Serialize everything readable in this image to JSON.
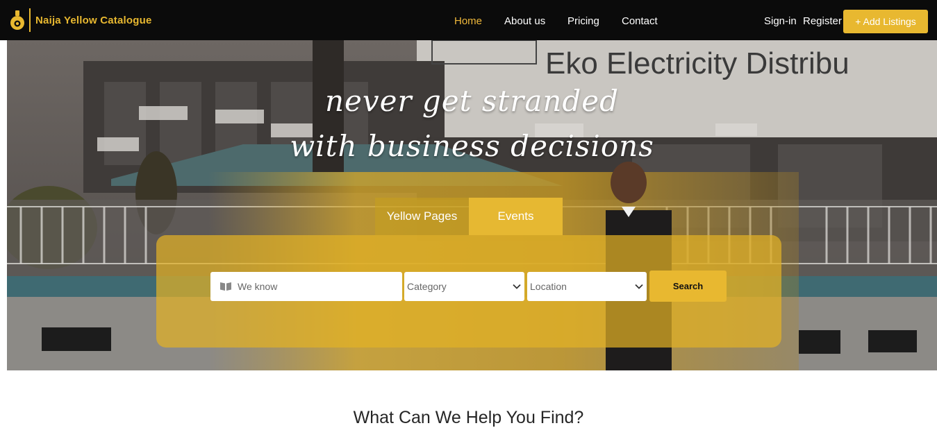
{
  "brand": {
    "name": "Naija Yellow Catalogue",
    "logo_icon": "bulb-logo-icon",
    "color": "#e8b830"
  },
  "nav": {
    "links": [
      {
        "label": "Home",
        "active": true
      },
      {
        "label": "About us"
      },
      {
        "label": "Pricing"
      },
      {
        "label": "Contact"
      }
    ],
    "signin": "Sign-in",
    "register": "Register",
    "add_listing": "+ Add Listings"
  },
  "hero": {
    "headline_1": "never get stranded",
    "headline_2": "with business decisions",
    "background_sign": "Eko Electricity Distribu",
    "tabs": [
      {
        "label": "Yellow Pages"
      },
      {
        "label": "Events",
        "active": true
      }
    ],
    "search": {
      "keyword_placeholder": "We know",
      "keyword_icon": "book-icon",
      "category_value": "Category",
      "location_value": "Location",
      "button": "Search"
    }
  },
  "section": {
    "title": "What Can We Help You Find?"
  },
  "colors": {
    "accent": "#e8b830",
    "navbar": "#0b0b0b",
    "active_link": "#f0b93b"
  }
}
